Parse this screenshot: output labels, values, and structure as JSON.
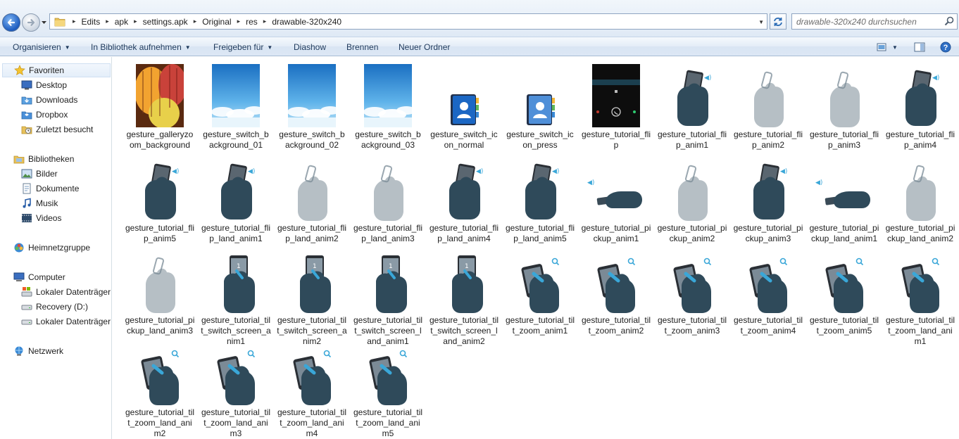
{
  "addressbar": {
    "crumbs": [
      "Edits",
      "apk",
      "settings.apk",
      "Original",
      "res",
      "drawable-320x240"
    ],
    "search_placeholder": "drawable-320x240 durchsuchen"
  },
  "toolbar": {
    "organize": "Organisieren",
    "library": "In Bibliothek aufnehmen",
    "share": "Freigeben für",
    "slideshow": "Diashow",
    "burn": "Brennen",
    "new_folder": "Neuer Ordner"
  },
  "sidebar": {
    "favorites": "Favoriten",
    "desktop": "Desktop",
    "downloads": "Downloads",
    "dropbox": "Dropbox",
    "recent": "Zuletzt besucht",
    "libraries": "Bibliotheken",
    "pictures": "Bilder",
    "documents": "Dokumente",
    "music": "Musik",
    "videos": "Videos",
    "homegroup": "Heimnetzgruppe",
    "computer": "Computer",
    "local_disk_1": "Lokaler Datenträger",
    "recovery": "Recovery (D:)",
    "local_disk_2": "Lokaler Datenträger",
    "network": "Netzwerk"
  },
  "files": [
    {
      "name": "gesture_galleryzoom_background",
      "kind": "balloons"
    },
    {
      "name": "gesture_switch_background_01",
      "kind": "sky"
    },
    {
      "name": "gesture_switch_background_02",
      "kind": "sky"
    },
    {
      "name": "gesture_switch_background_03",
      "kind": "sky"
    },
    {
      "name": "gesture_switch_icon_normal",
      "kind": "contacts"
    },
    {
      "name": "gesture_switch_icon_press",
      "kind": "contacts-light"
    },
    {
      "name": "gesture_tutorial_flip",
      "kind": "phone-dark"
    },
    {
      "name": "gesture_tutorial_flip_anim1",
      "kind": "hand-phone"
    },
    {
      "name": "gesture_tutorial_flip_anim2",
      "kind": "hand-faded"
    },
    {
      "name": "gesture_tutorial_flip_anim3",
      "kind": "hand-faded"
    },
    {
      "name": "gesture_tutorial_flip_anim4",
      "kind": "hand-phone"
    },
    {
      "name": "gesture_tutorial_flip_anim5",
      "kind": "hand-phone"
    },
    {
      "name": "gesture_tutorial_flip_land_anim1",
      "kind": "hand-phone"
    },
    {
      "name": "gesture_tutorial_flip_land_anim2",
      "kind": "hand-faded"
    },
    {
      "name": "gesture_tutorial_flip_land_anim3",
      "kind": "hand-faded"
    },
    {
      "name": "gesture_tutorial_flip_land_anim4",
      "kind": "hand-phone"
    },
    {
      "name": "gesture_tutorial_flip_land_anim5",
      "kind": "hand-phone"
    },
    {
      "name": "gesture_tutorial_pickup_anim1",
      "kind": "hand-flat"
    },
    {
      "name": "gesture_tutorial_pickup_anim2",
      "kind": "hand-faded"
    },
    {
      "name": "gesture_tutorial_pickup_anim3",
      "kind": "hand-phone"
    },
    {
      "name": "gesture_tutorial_pickup_land_anim1",
      "kind": "hand-flat"
    },
    {
      "name": "gesture_tutorial_pickup_land_anim2",
      "kind": "hand-faded"
    },
    {
      "name": "gesture_tutorial_pickup_land_anim3",
      "kind": "hand-faded"
    },
    {
      "name": "gesture_tutorial_tilt_switch_screen_anim1",
      "kind": "hand-screen"
    },
    {
      "name": "gesture_tutorial_tilt_switch_screen_anim2",
      "kind": "hand-screen"
    },
    {
      "name": "gesture_tutorial_tilt_switch_screen_land_anim1",
      "kind": "hand-screen"
    },
    {
      "name": "gesture_tutorial_tilt_switch_screen_land_anim2",
      "kind": "hand-screen"
    },
    {
      "name": "gesture_tutorial_tilt_zoom_anim1",
      "kind": "hand-zoom"
    },
    {
      "name": "gesture_tutorial_tilt_zoom_anim2",
      "kind": "hand-zoom"
    },
    {
      "name": "gesture_tutorial_tilt_zoom_anim3",
      "kind": "hand-zoom"
    },
    {
      "name": "gesture_tutorial_tilt_zoom_anim4",
      "kind": "hand-zoom"
    },
    {
      "name": "gesture_tutorial_tilt_zoom_anim5",
      "kind": "hand-zoom"
    },
    {
      "name": "gesture_tutorial_tilt_zoom_land_anim1",
      "kind": "hand-zoom"
    },
    {
      "name": "gesture_tutorial_tilt_zoom_land_anim2",
      "kind": "hand-zoom"
    },
    {
      "name": "gesture_tutorial_tilt_zoom_land_anim3",
      "kind": "hand-zoom"
    },
    {
      "name": "gesture_tutorial_tilt_zoom_land_anim4",
      "kind": "hand-zoom"
    },
    {
      "name": "gesture_tutorial_tilt_zoom_land_anim5",
      "kind": "hand-zoom"
    }
  ],
  "colors": {
    "toolbar_text": "#1e395b",
    "hand": "#2f4a5a",
    "accent_blue": "#3aa7d8"
  }
}
